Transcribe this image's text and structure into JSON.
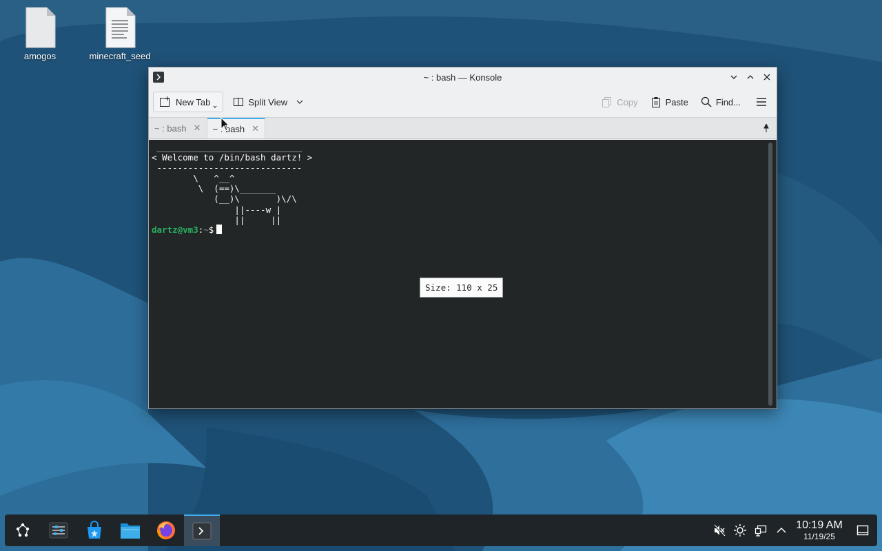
{
  "desktop": {
    "icons": [
      {
        "label": "amogos",
        "icon": "blank-file-icon"
      },
      {
        "label": "minecraft_seed",
        "icon": "text-file-icon"
      }
    ]
  },
  "window": {
    "title": "~ : bash — Konsole",
    "toolbar": {
      "new_tab": "New Tab",
      "split_view": "Split View",
      "copy": "Copy",
      "paste": "Paste",
      "find": "Find..."
    },
    "tabs": [
      {
        "label": "~ : bash",
        "active": false
      },
      {
        "label": "~ : bash",
        "active": true
      }
    ],
    "terminal": {
      "banner": " ____________________________\n< Welcome to /bin/bash dartz! >\n ----------------------------\n        \\   ^__^\n         \\  (==)\\_______\n            (__)\\       )\\/\\\n                ||----w |\n                ||     ||",
      "prompt_user": "dartz@vm3",
      "prompt_sep": ":",
      "prompt_path": "~",
      "prompt_symbol": "$",
      "size_tooltip": "Size: 110 x 25"
    }
  },
  "taskbar": {
    "items": [
      "application-launcher-icon",
      "system-settings-icon",
      "discover-store-icon",
      "dolphin-file-manager-icon",
      "firefox-icon",
      "konsole-icon"
    ],
    "tray": [
      "volume-muted-icon",
      "brightness-icon",
      "network-icon",
      "tray-expand-icon",
      "show-desktop-icon"
    ],
    "time": "10:19 AM",
    "date": "11/19/25"
  },
  "colors": {
    "accent": "#3daee9",
    "terminal_bg": "#232627",
    "prompt_green": "#27ae60",
    "panel_bg": "#1f2428"
  }
}
